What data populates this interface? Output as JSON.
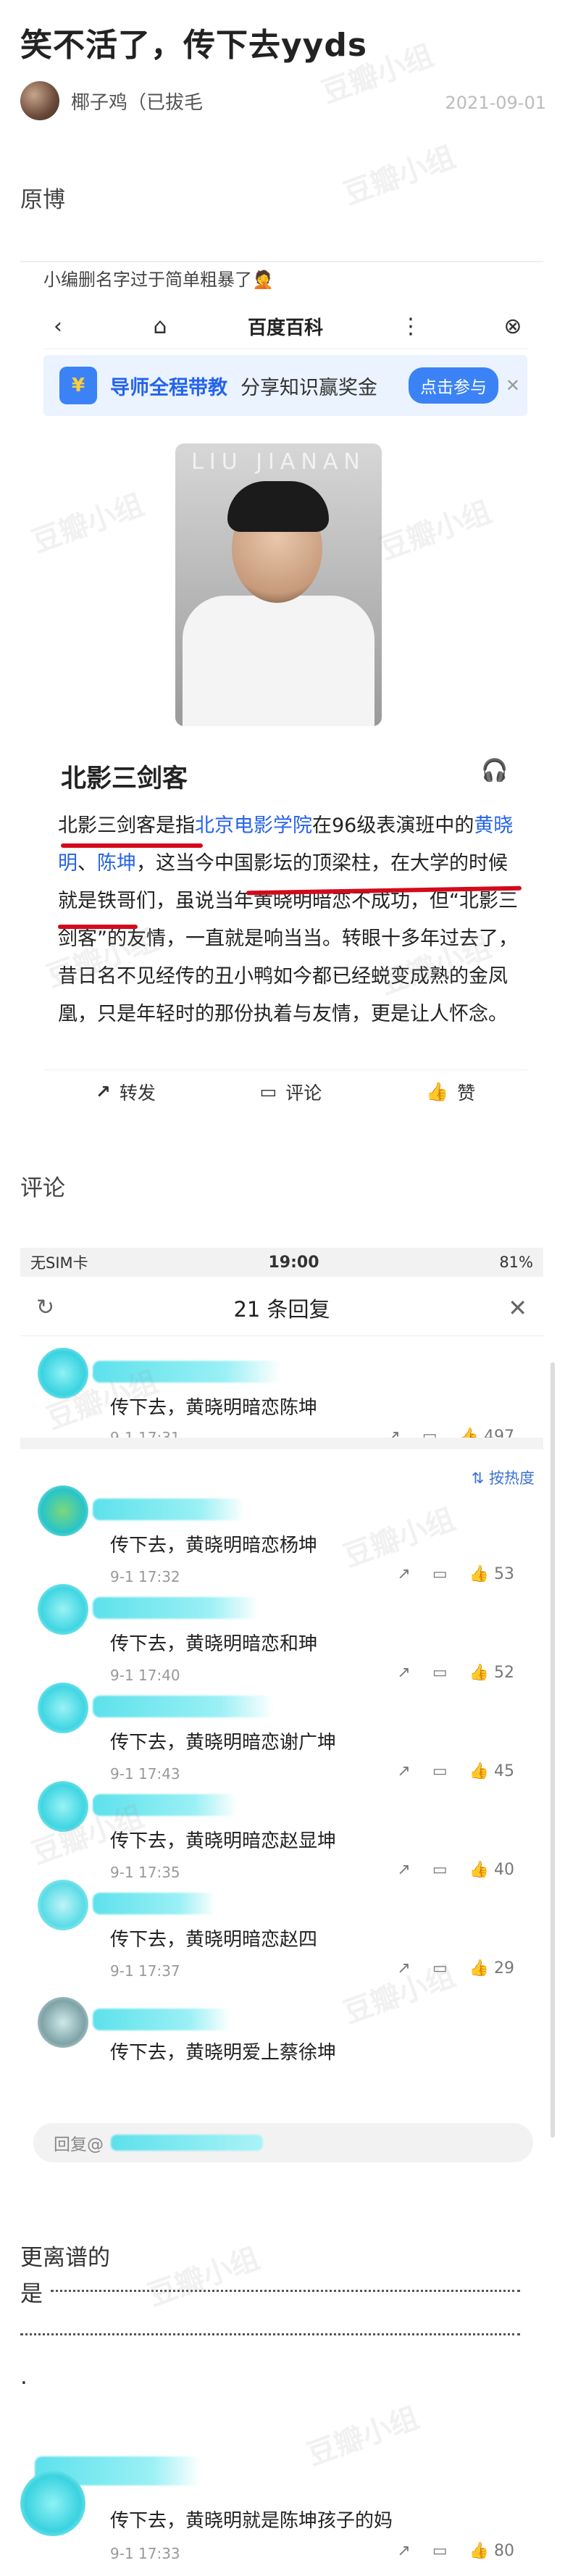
{
  "post": {
    "title": "笑不活了，传下去yyds",
    "author": "椰子鸡（已拔毛",
    "date": "2021-09-01",
    "section_original": "原博",
    "section_comments": "评论"
  },
  "original": {
    "note": "小编删名字过于简单粗暴了🤦",
    "baike_title": "百度百科",
    "banner_title": "导师全程带教",
    "banner_subtitle": "分享知识赢奖金",
    "banner_cta": "点击参与",
    "photo_text": "LIU JIANAN",
    "entry_heading": "北影三剑客",
    "entry_p1": "北影三剑客是指",
    "entry_link1": "北京电影学院",
    "entry_p2": "在96级表演班中的",
    "entry_link2": "黄晓明",
    "entry_sep": "、",
    "entry_link3": "陈坤",
    "entry_p3": "，这当今中国影坛的顶梁柱，在大学的时候就是铁哥们，虽说当年黄晓明暗恋不成功，但“北影三剑客”的友情，一直就是响当当。转眼十多年过去了，昔日名不见经传的丑小鸭如今都已经蜕变成熟的金凤凰，只是年轻时的那份执着与友情，更是让人怀念。",
    "action_share": "转发",
    "action_comment": "评论",
    "action_like": "赞"
  },
  "comments_screen": {
    "carrier": "无SIM卡",
    "time": "19:00",
    "battery": "81%",
    "count_label": "21 条回复",
    "sort_label": "按热度",
    "reply_placeholder": "回复@",
    "items": [
      {
        "text": "传下去，黄晓明暗恋陈坤",
        "time": "9-1 17:31",
        "likes": "497"
      },
      {
        "text": "传下去，黄晓明暗恋杨坤",
        "time": "9-1 17:32",
        "likes": "53"
      },
      {
        "text": "传下去，黄晓明暗恋和珅",
        "time": "9-1 17:40",
        "likes": "52"
      },
      {
        "text": "传下去，黄晓明暗恋谢广坤",
        "time": "9-1 17:43",
        "likes": "45"
      },
      {
        "text": "传下去，黄晓明暗恋赵显坤",
        "time": "9-1 17:35",
        "likes": "40"
      },
      {
        "text": "传下去，黄晓明暗恋赵四",
        "time": "9-1 17:37",
        "likes": "29"
      },
      {
        "text": "传下去，黄晓明爱上蔡徐坤",
        "time": "",
        "likes": ""
      }
    ]
  },
  "tail": {
    "line1": "更离谱的",
    "line2": "是",
    "line4": ".",
    "last_text": "传下去，黄晓明就是陈坤孩子的妈",
    "last_time": "9-1 17:33",
    "last_likes": "80"
  },
  "watermark": "豆瓣小组"
}
